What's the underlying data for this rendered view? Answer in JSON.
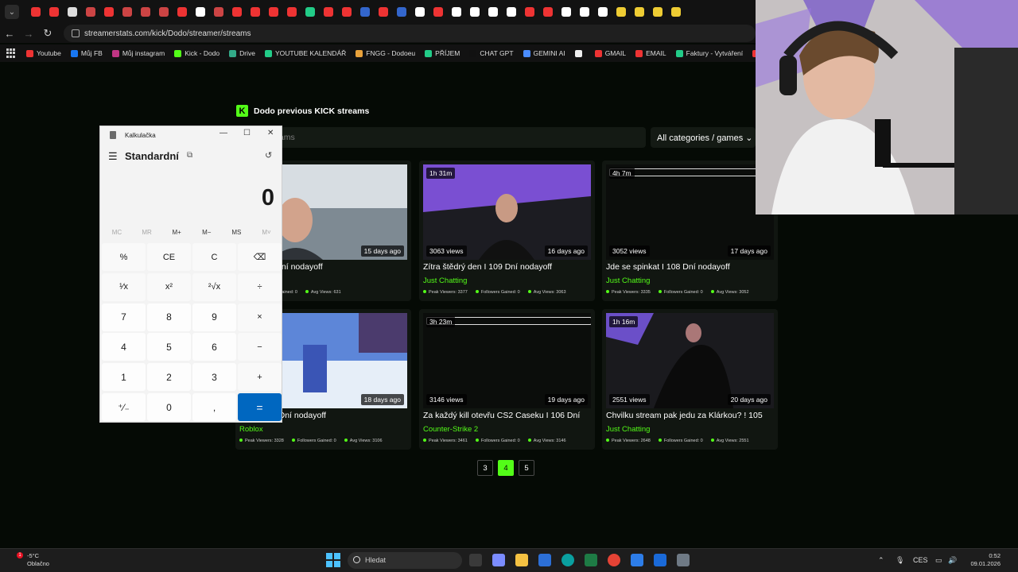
{
  "browser": {
    "url": "streamerstats.com/kick/Dodo/streamer/streams",
    "bookmarks": [
      "Youtube",
      "Můj FB",
      "Můj instagram",
      "Kick - Dodo",
      "Drive",
      "YOUTUBE KALENDÁŘ",
      "FNGG - Dodoeu",
      "PŘÍJEM",
      "CHAT GPT",
      "GEMINI AI",
      "",
      "GMAIL",
      "EMAIL",
      "Faktury - Vytváření",
      "PNG to PD"
    ]
  },
  "page": {
    "title": "Dodo previous KICK streams",
    "search_placeholder": "vious streams",
    "category_select": "All categories / games ⌄",
    "cards": [
      {
        "duration": "",
        "views": "",
        "ago": "15 days ago",
        "title": "oce I 110 Dní nodayoff",
        "category": "",
        "stats": [
          "",
          "Followers Gained: 0",
          "Avg Views: 631"
        ]
      },
      {
        "duration": "1h 31m",
        "views": "3063 views",
        "ago": "16 days ago",
        "title": "Zítra štědrý den I 109 Dní nodayoff",
        "category": "Just Chatting",
        "stats": [
          "Peak Viewers: 3377",
          "Followers Gained: 0",
          "Avg Views: 3063"
        ]
      },
      {
        "duration": "4h 7m",
        "views": "3052 views",
        "ago": "17 days ago",
        "title": "Jde se spinkat I 108 Dní nodayoff",
        "category": "Just Chatting",
        "stats": [
          "Peak Viewers: 3335",
          "Followers Gained: 0",
          "Avg Views: 3052"
        ]
      },
      {
        "duration": "",
        "views": "",
        "ago": "18 days ago",
        "title": "rek? I 107 Dní nodayoff",
        "category": "Roblox",
        "stats": [
          "Peak Viewers: 3328",
          "Followers Gained: 0",
          "Avg Views: 3106"
        ]
      },
      {
        "duration": "3h 23m",
        "views": "3146 views",
        "ago": "19 days ago",
        "title": "Za každý kill otevřu CS2 Caseku I 106 Dní",
        "category": "Counter-Strike 2",
        "stats": [
          "Peak Viewers: 3461",
          "Followers Gained: 0",
          "Avg Views: 3146"
        ]
      },
      {
        "duration": "1h 16m",
        "views": "2551 views",
        "ago": "20 days ago",
        "title": "Chvilku stream pak jedu za Klárkou? ! 105",
        "category": "Just Chatting",
        "stats": [
          "Peak Viewers: 2648",
          "Followers Gained: 0",
          "Avg Views: 2551"
        ]
      }
    ],
    "pages": [
      "3",
      "4",
      "5"
    ]
  },
  "calculator": {
    "window_title": "Kalkulačka",
    "mode": "Standardní",
    "display": "0",
    "memory": [
      "MC",
      "MR",
      "M+",
      "M−",
      "MS",
      "M˅"
    ],
    "keys": [
      "%",
      "CE",
      "C",
      "⌫",
      "¹⁄x",
      "x²",
      "²√x",
      "÷",
      "7",
      "8",
      "9",
      "×",
      "4",
      "5",
      "6",
      "−",
      "1",
      "2",
      "3",
      "+",
      "⁺⁄₋",
      "0",
      ",",
      "="
    ]
  },
  "taskbar": {
    "weather_temp": "-5°C",
    "weather_desc": "Oblačno",
    "notification_count": "1",
    "search_placeholder": "Hledat",
    "language": "CES",
    "time": "0:52",
    "date": "09.01.2026"
  },
  "colors": {
    "kick_green": "#53fc18",
    "windows_blue": "#0067c0"
  }
}
